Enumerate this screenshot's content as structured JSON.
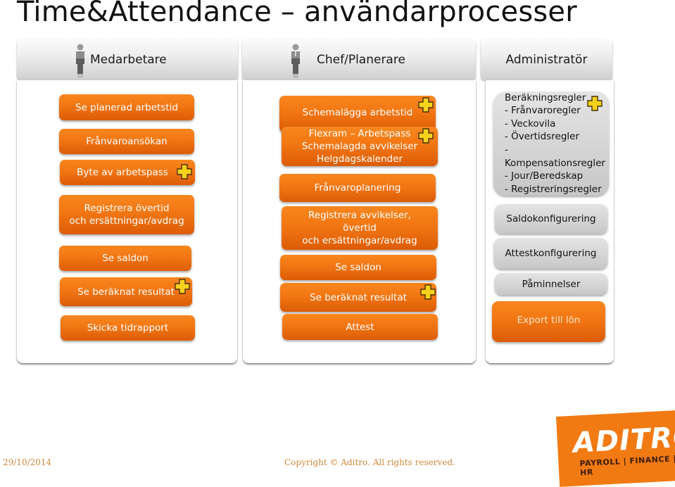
{
  "title": "Time&Attendance – användarprocesser",
  "colors": {
    "accent_orange": "#f27613",
    "panel_grey": "#d3d3d3",
    "plus_yellow": "#f7d21c",
    "footer_text": "#d08a3c"
  },
  "columns": [
    {
      "header": "Medarbetare",
      "icon": "person-icon",
      "items": [
        {
          "label": "Se planerad arbetstid",
          "plus": false
        },
        {
          "label": "Frånvaroansökan",
          "plus": false
        },
        {
          "label": "Byte av arbetspass",
          "plus": true
        },
        {
          "label": "Registrera övertid\noch ersättningar/avdrag",
          "line1": "Registrera övertid",
          "line2": "och ersättningar/avdrag",
          "plus": false
        },
        {
          "label": "Se saldon",
          "plus": false
        },
        {
          "label": "Se beräknat resultat",
          "plus": true
        },
        {
          "label": "Skicka tidrapport",
          "plus": false
        }
      ]
    },
    {
      "header": "Chef/Planerare",
      "icon": "manager-person-icon",
      "items": [
        {
          "label": "Schemalägga arbetstid",
          "plus": true
        },
        {
          "line1": "Flexram – Arbetspass",
          "line2": "Schemalagda avvikelser",
          "line3": "Helgdagskalender",
          "plus": true
        },
        {
          "label": "Frånvaroplanering",
          "plus": false
        },
        {
          "line1": "Registrera avvikelser,",
          "line2": "övertid",
          "line3": "och ersättningar/avdrag",
          "plus": false
        },
        {
          "label": "Se saldon",
          "plus": false
        },
        {
          "label": "Se beräknat resultat",
          "plus": true
        },
        {
          "label": "Attest",
          "plus": false
        }
      ]
    },
    {
      "header": "Administratör",
      "items": [
        {
          "lines": [
            "Beräkningsregler",
            "- Frånvaroregler",
            "- Veckovila",
            "- Övertidsregler",
            "- Kompensationsregler",
            "- Jour/Beredskap",
            "- Registreringsregler"
          ],
          "plus": true
        },
        {
          "label": "Saldokonfigurering",
          "plus": false
        },
        {
          "label": "Attestkonfigurering",
          "plus": false
        },
        {
          "label": "Påminnelser",
          "plus": false
        },
        {
          "label": "Export till lön",
          "plus": false
        }
      ]
    }
  ],
  "footer": {
    "date": "29/10/2014",
    "copyright": "Copyright © Aditro. All rights reserved."
  },
  "logo": {
    "brand": "ADITRO",
    "tagline": "PAYROLL | FINANCE | HR"
  }
}
